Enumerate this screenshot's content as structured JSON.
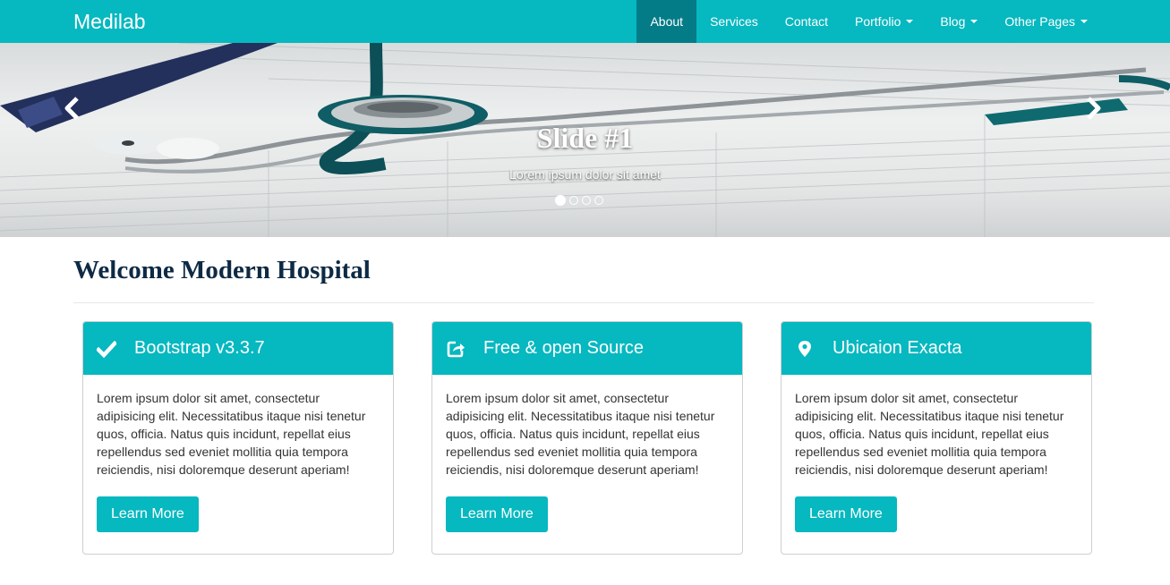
{
  "navbar": {
    "brand": "Medilab",
    "items": [
      {
        "label": "About",
        "active": true
      },
      {
        "label": "Services"
      },
      {
        "label": "Contact"
      },
      {
        "label": "Portfolio",
        "dropdown": true
      },
      {
        "label": "Blog",
        "dropdown": true
      },
      {
        "label": "Other Pages",
        "dropdown": true
      }
    ],
    "accent": "#06b8c0",
    "active_color": "#037c88"
  },
  "carousel": {
    "title": "Slide #1",
    "subtitle": "Lorem ipsum dolor sit amet",
    "slide_count": 4,
    "active_index": 0,
    "prev_icon": "chevron-left-icon",
    "next_icon": "chevron-right-icon"
  },
  "main": {
    "title": "Welcome Modern Hospital",
    "panels": [
      {
        "icon": "check-icon",
        "title": "Bootstrap v3.3.7",
        "text": "Lorem ipsum dolor sit amet, consectetur adipisicing elit. Necessitatibus itaque nisi tenetur quos, officia. Natus quis incidunt, repellat eius repellendus sed eveniet mollitia quia tempora reiciendis, nisi doloremque deserunt aperiam!",
        "button": "Learn More"
      },
      {
        "icon": "share-icon",
        "title": "Free & open Source",
        "text": "Lorem ipsum dolor sit amet, consectetur adipisicing elit. Necessitatibus itaque nisi tenetur quos, officia. Natus quis incidunt, repellat eius repellendus sed eveniet mollitia quia tempora reiciendis, nisi doloremque deserunt aperiam!",
        "button": "Learn More"
      },
      {
        "icon": "map-marker-icon",
        "title": "Ubicaion Exacta",
        "text": "Lorem ipsum dolor sit amet, consectetur adipisicing elit. Necessitatibus itaque nisi tenetur quos, officia. Natus quis incidunt, repellat eius repellendus sed eveniet mollitia quia tempora reiciendis, nisi doloremque deserunt aperiam!",
        "button": "Learn More"
      }
    ]
  }
}
